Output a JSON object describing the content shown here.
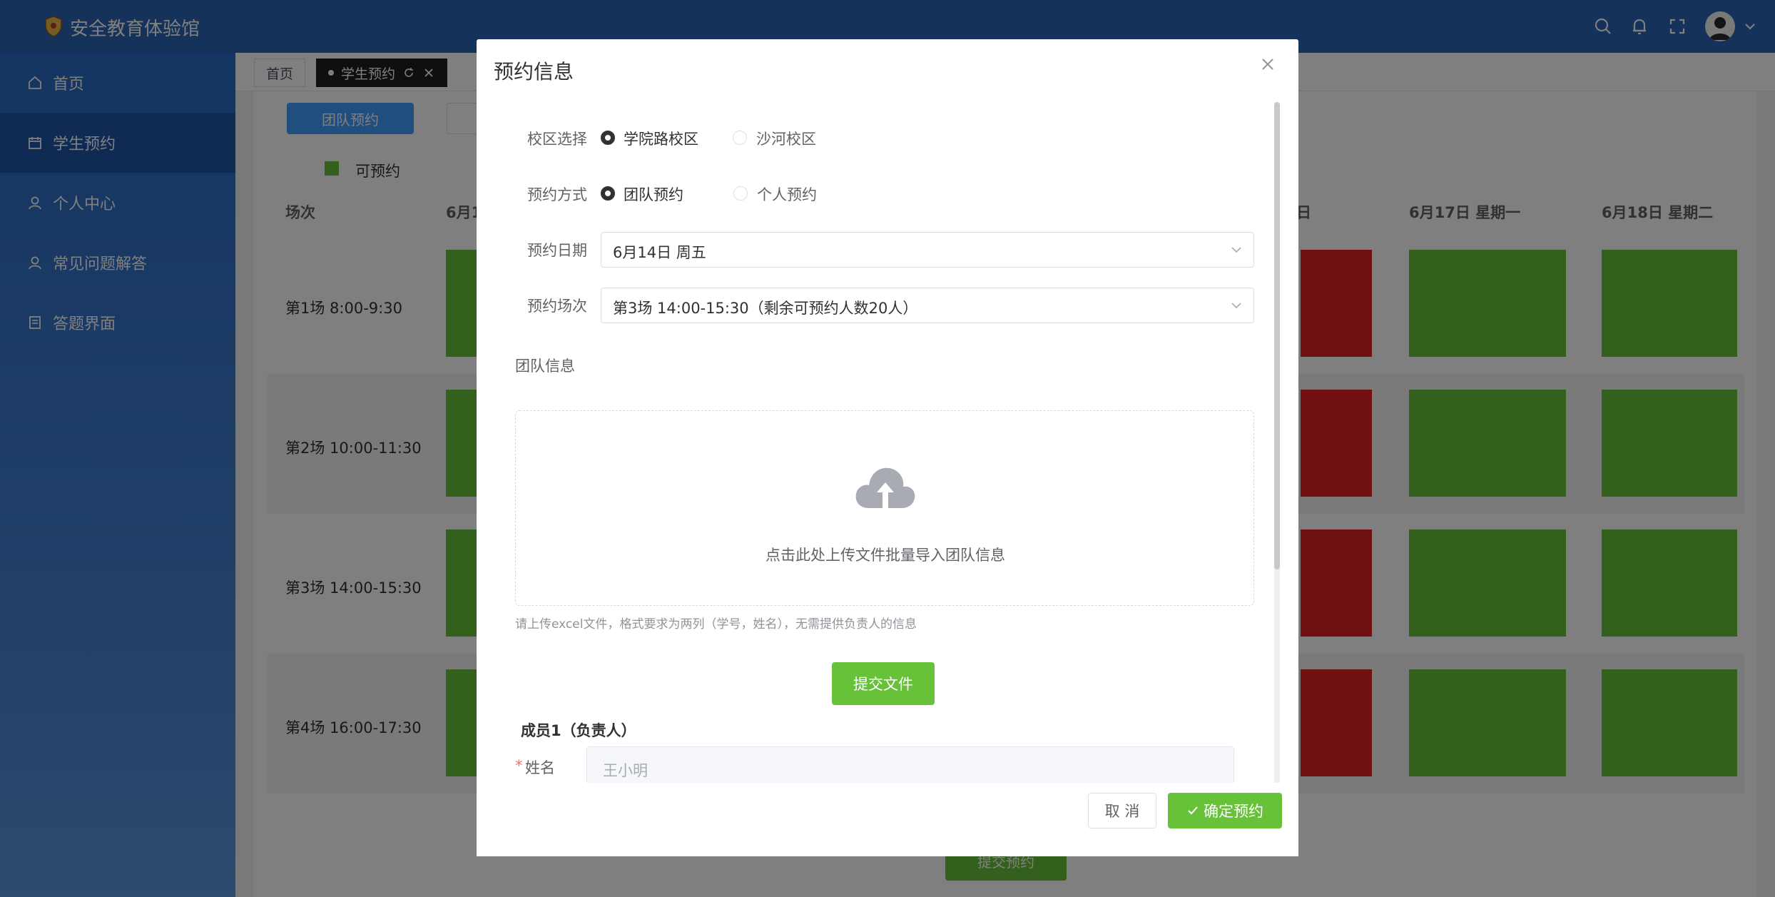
{
  "app": {
    "title": "安全教育体验馆"
  },
  "sidebar": {
    "items": [
      {
        "label": "首页",
        "icon": "home-icon"
      },
      {
        "label": "学生预约",
        "icon": "calendar-icon"
      },
      {
        "label": "个人中心",
        "icon": "user-icon"
      },
      {
        "label": "常见问题解答",
        "icon": "user-icon"
      },
      {
        "label": "答题界面",
        "icon": "document-icon"
      }
    ]
  },
  "tabs": [
    {
      "label": "首页"
    },
    {
      "label": "学生预约"
    }
  ],
  "main": {
    "team_button": "团队预约",
    "legend_label": "可预约",
    "columns": [
      "场次",
      "6月1",
      "日",
      "6月17日 星期一",
      "6月18日 星期二"
    ],
    "rows": [
      {
        "label": "第1场 8:00-9:30"
      },
      {
        "label": "第2场 10:00-11:30"
      },
      {
        "label": "第3场 14:00-15:30"
      },
      {
        "label": "第4场 16:00-17:30"
      }
    ],
    "submit_label": "提交预约"
  },
  "dialog": {
    "title": "预约信息",
    "campus": {
      "label": "校区选择",
      "options": [
        "学院路校区",
        "沙河校区"
      ],
      "selected": "学院路校区"
    },
    "mode": {
      "label": "预约方式",
      "options": [
        "团队预约",
        "个人预约"
      ],
      "selected": "团队预约"
    },
    "date": {
      "label": "预约日期",
      "value": "6月14日 周五"
    },
    "session": {
      "label": "预约场次",
      "value": "第3场 14:00-15:30（剩余可预约人数20人）"
    },
    "team_section": "团队信息",
    "upload_text": "点击此处上传文件批量导入团队信息",
    "upload_hint": "请上传excel文件，格式要求为两列（学号，姓名），无需提供负责人的信息",
    "upload_button": "提交文件",
    "member_title": "成员1（负责人）",
    "name_label": "姓名",
    "name_required": "*",
    "name_placeholder": "王小明",
    "cancel_label": "取 消",
    "confirm_label": "确定预约"
  },
  "colors": {
    "header": "#2a64b6",
    "available": "#67c23a",
    "full": "#e02020",
    "primary": "#409eff"
  }
}
